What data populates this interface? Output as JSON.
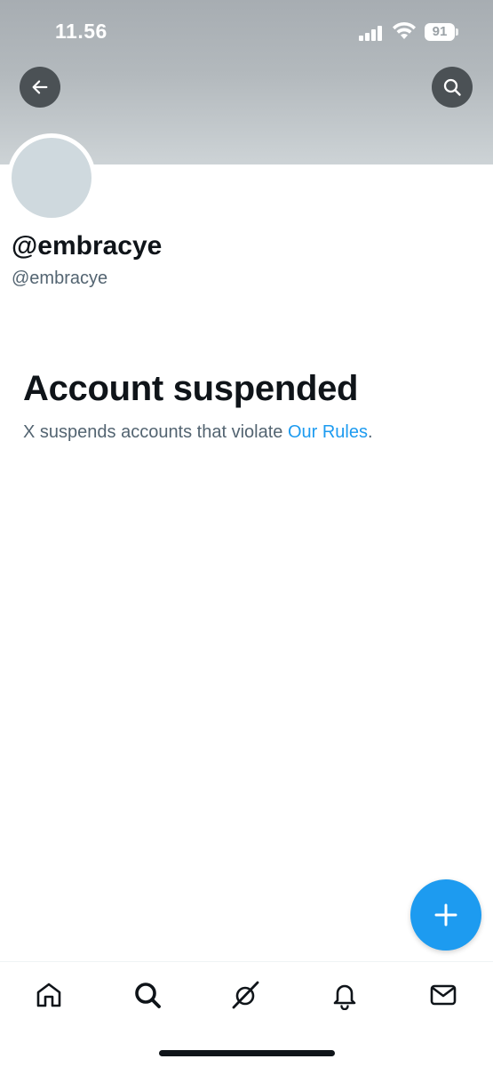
{
  "status_bar": {
    "time": "11.56",
    "battery_level": "91"
  },
  "profile": {
    "display_name": "@embracye",
    "handle": "@embracye"
  },
  "suspension": {
    "title": "Account suspended",
    "message": "X suspends accounts that violate ",
    "link_text": "Our Rules",
    "suffix": "."
  },
  "icons": {
    "back": "arrow-left-icon",
    "search": "search-icon",
    "compose": "plus-icon",
    "nav": [
      "home-icon",
      "search-icon",
      "grok-icon",
      "bell-icon",
      "mail-icon"
    ]
  },
  "colors": {
    "accent": "#1d9bf0",
    "text_primary": "#0f1419",
    "text_secondary": "#536471",
    "banner": "#b3b9bd"
  }
}
